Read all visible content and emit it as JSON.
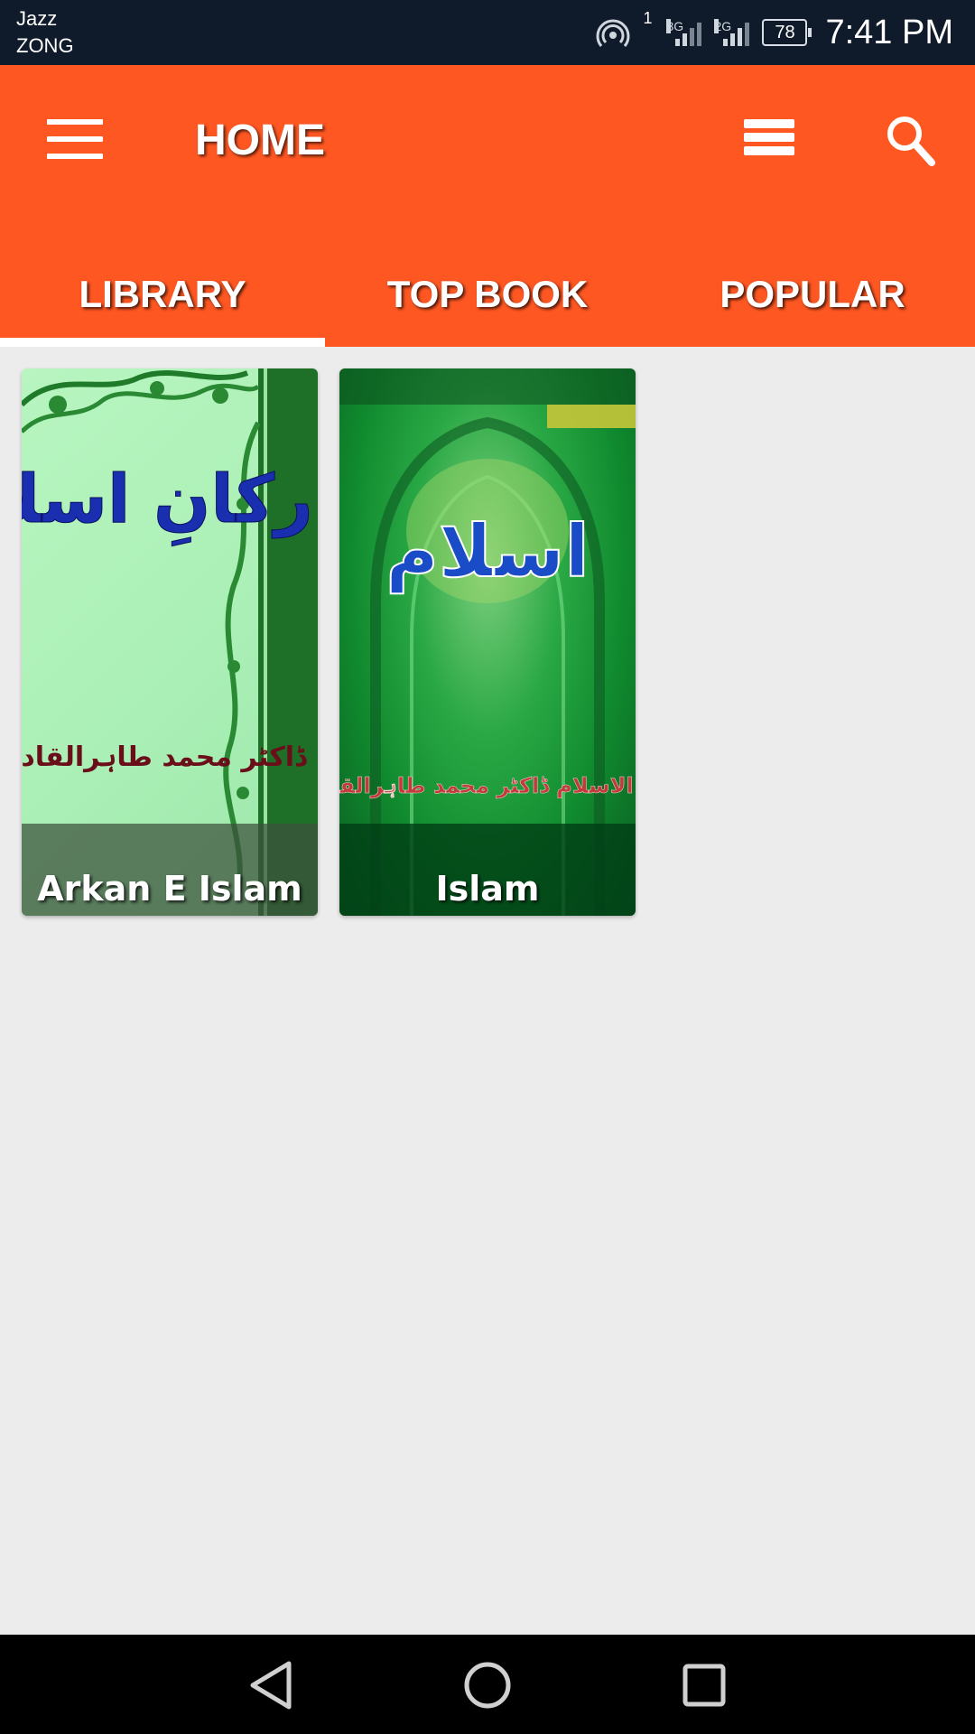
{
  "status_bar": {
    "carrier_1": "Jazz",
    "carrier_2": "ZONG",
    "sim1_label": "1",
    "net1_label": "3G",
    "net2_label": "2G",
    "battery": "78",
    "time": "7:41 PM"
  },
  "app_bar": {
    "title": "HOME",
    "color": "#ff5722",
    "icons": [
      "menu-icon",
      "list-icon",
      "search-icon"
    ]
  },
  "tabs": [
    {
      "label": "LIBRARY",
      "active": true
    },
    {
      "label": "TOP BOOK",
      "active": false
    },
    {
      "label": "POPULAR",
      "active": false
    }
  ],
  "books": [
    {
      "title": "Arkan E Islam",
      "cover_text": "ارکانِ اسلام",
      "cover_author": "ڈاکٹر محمد طاہرالقادری"
    },
    {
      "title": "Islam",
      "cover_text": "اسلام",
      "cover_author": "شیخ الاسلام ڈاکٹر محمد طاہرالقادری"
    }
  ],
  "nav_bar": {
    "icons": [
      "back-icon",
      "home-icon",
      "recents-icon"
    ]
  }
}
